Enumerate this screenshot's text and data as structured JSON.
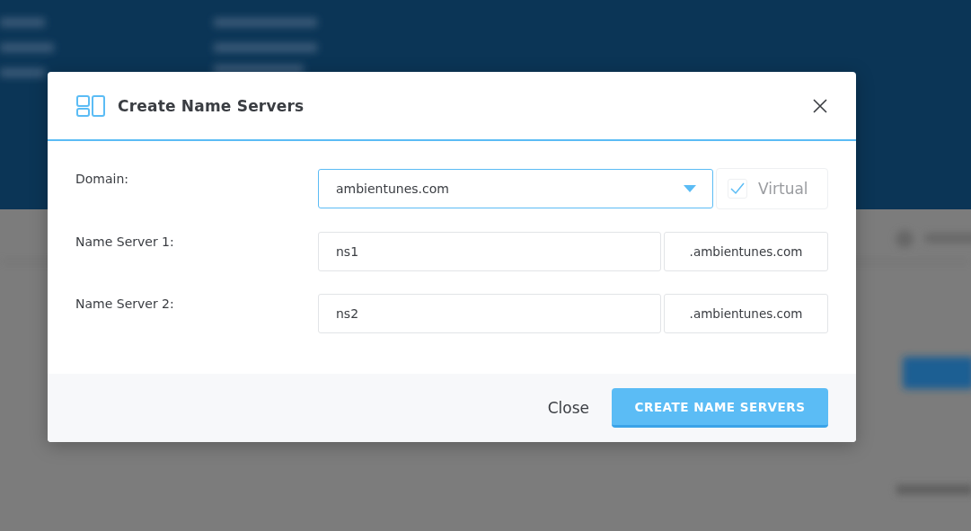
{
  "dialog": {
    "title": "Create Name Servers",
    "fields": [
      {
        "kind": "select",
        "label": "Domain:",
        "value": "ambientunes.com",
        "checkbox": {
          "label": "Virtual",
          "checked": true
        }
      },
      {
        "kind": "input",
        "label": "Name Server 1:",
        "value": "ns1",
        "suffix": ".ambientunes.com"
      },
      {
        "kind": "input",
        "label": "Name Server 2:",
        "value": "ns2",
        "suffix": ".ambientunes.com"
      }
    ],
    "buttons": [
      {
        "kind": "link",
        "label": "Close"
      },
      {
        "kind": "primary",
        "label": "CREATE NAME SERVERS"
      }
    ]
  }
}
